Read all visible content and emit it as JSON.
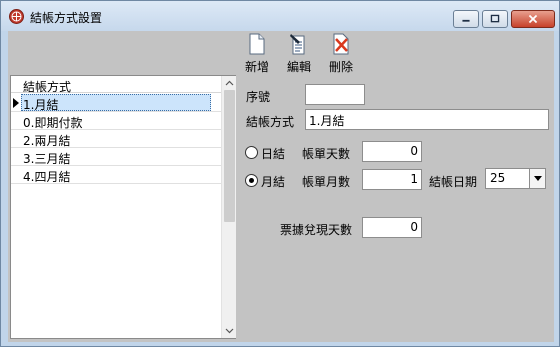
{
  "window": {
    "title": "結帳方式設置",
    "accent": "#c1d5ea",
    "close_color": "#c7412a"
  },
  "toolbar": {
    "new_label": "新增",
    "edit_label": "編輯",
    "delete_label": "刪除"
  },
  "list": {
    "header": "結帳方式",
    "rows": [
      {
        "label": "1.月結",
        "selected": true
      },
      {
        "label": "0.即期付款",
        "selected": false
      },
      {
        "label": "2.兩月結",
        "selected": false
      },
      {
        "label": "3.三月結",
        "selected": false
      },
      {
        "label": "4.四月結",
        "selected": false
      }
    ]
  },
  "form": {
    "serial_label": "序號",
    "serial_value": "",
    "method_label": "結帳方式",
    "method_value": "1.月結",
    "daily_radio_label": "日結",
    "daily_checked": false,
    "days_label": "帳單天數",
    "days_value": "0",
    "monthly_radio_label": "月結",
    "monthly_checked": true,
    "months_label": "帳單月數",
    "months_value": "1",
    "close_day_label": "結帳日期",
    "close_day_value": "25",
    "ticket_days_label": "票據兌現天數",
    "ticket_days_value": "0"
  },
  "icons": {
    "app": "globe-icon",
    "new": "new-document-icon",
    "edit": "edit-document-icon",
    "delete": "delete-document-icon"
  }
}
